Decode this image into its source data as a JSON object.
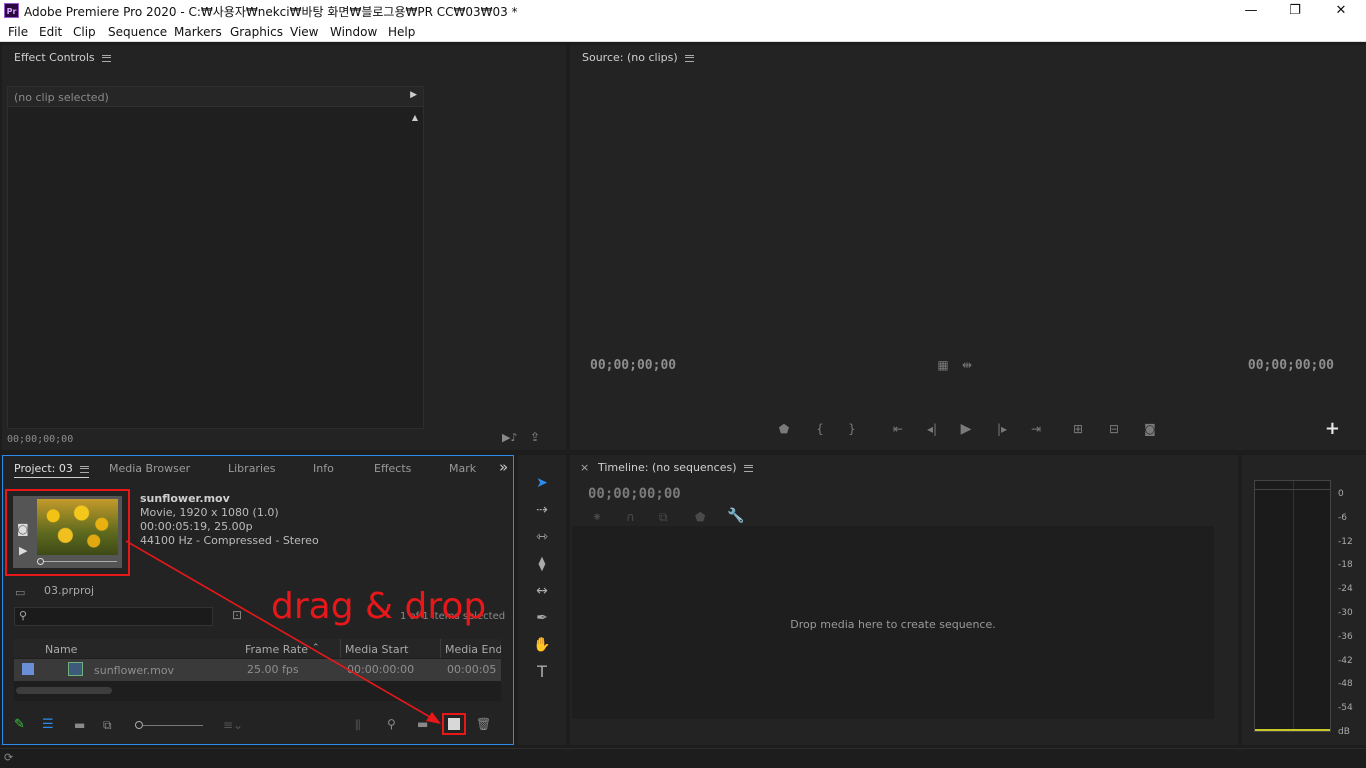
{
  "titlebar": {
    "app_icon": "Pr",
    "title": "Adobe Premiere Pro 2020 - C:₩사용자₩nekci₩바탕 화면₩블로그용₩PR CC₩03₩03 *",
    "minimize": "—",
    "restore": "❐",
    "close": "✕"
  },
  "menubar": [
    "File",
    "Edit",
    "Clip",
    "Sequence",
    "Markers",
    "Graphics",
    "View",
    "Window",
    "Help"
  ],
  "effect_controls": {
    "tab_label": "Effect Controls",
    "no_clip": "(no clip selected)",
    "timecode": "00;00;00;00"
  },
  "source": {
    "tab_label": "Source: (no clips)",
    "timecode_left": "00;00;00;00",
    "timecode_right": "00;00;00;00",
    "add_button": "+"
  },
  "project": {
    "tabs": [
      "Project: 03",
      "Media Browser",
      "Libraries",
      "Info",
      "Effects",
      "Mark"
    ],
    "more": "»",
    "clip_name": "sunflower.mov",
    "clip_info": [
      "Movie, 1920 x 1080 (1.0)",
      "00:00:05:19, 25.00p",
      "44100 Hz - Compressed - Stereo"
    ],
    "project_file": "03.prproj",
    "items_selected": "1 of 1 items selected",
    "columns": [
      "Name",
      "Frame Rate",
      "Media Start",
      "Media End"
    ],
    "rows": [
      {
        "name": "sunflower.mov",
        "frame_rate": "25.00 fps",
        "media_start": "00:00:00:00",
        "media_end": "00:00:05"
      }
    ]
  },
  "timeline": {
    "tab_label": "Timeline: (no sequences)",
    "close": "×",
    "timecode": "00;00;00;00",
    "drop_hint": "Drop media here to create sequence."
  },
  "audio_meter": {
    "scale": [
      "0",
      "-6",
      "-12",
      "-18",
      "-24",
      "-30",
      "-36",
      "-42",
      "-48",
      "-54",
      "dB"
    ]
  },
  "annotation": {
    "text": "drag & drop",
    "color": "#e8181a"
  },
  "colors": {
    "accent": "#2d8ceb",
    "annotation_red": "#e8181a"
  }
}
